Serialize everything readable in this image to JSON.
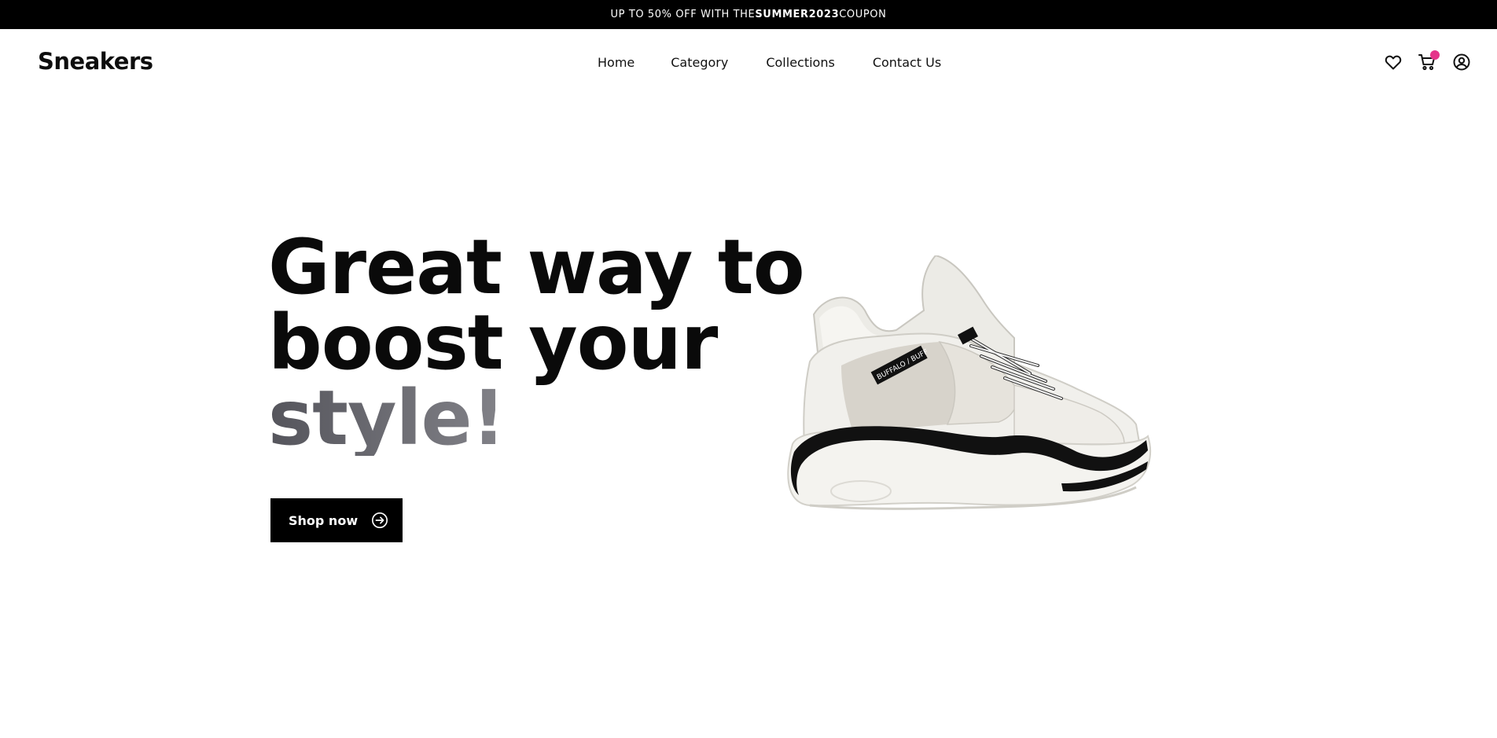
{
  "promo": {
    "prefix": "UP TO 50% OFF WITH THE ",
    "code": "SUMMER2023",
    "suffix": " COUPON"
  },
  "brand": {
    "logo": "Sneakers"
  },
  "nav": {
    "items": [
      {
        "label": "Home"
      },
      {
        "label": "Category"
      },
      {
        "label": "Collections"
      },
      {
        "label": "Contact Us"
      }
    ]
  },
  "header_icons": [
    "heart-icon",
    "cart-icon",
    "user-icon"
  ],
  "cart": {
    "has_items": true,
    "badge_color": "#e5348a"
  },
  "hero": {
    "title_line1": "Great way to",
    "title_line2": "boost your",
    "title_line3": "style!",
    "cta_label": "Shop now",
    "cta_icon": "arrow-right-circle-icon",
    "image": "white-sneaker-image",
    "sneaker_label": "BUFFALO / BUFF"
  },
  "colors": {
    "promo_bg": "#000000",
    "text": "#0a0a0a",
    "accent_gradient_start": "#55555c",
    "accent_gradient_end": "#a9a9ad",
    "cta_bg": "#000000"
  }
}
